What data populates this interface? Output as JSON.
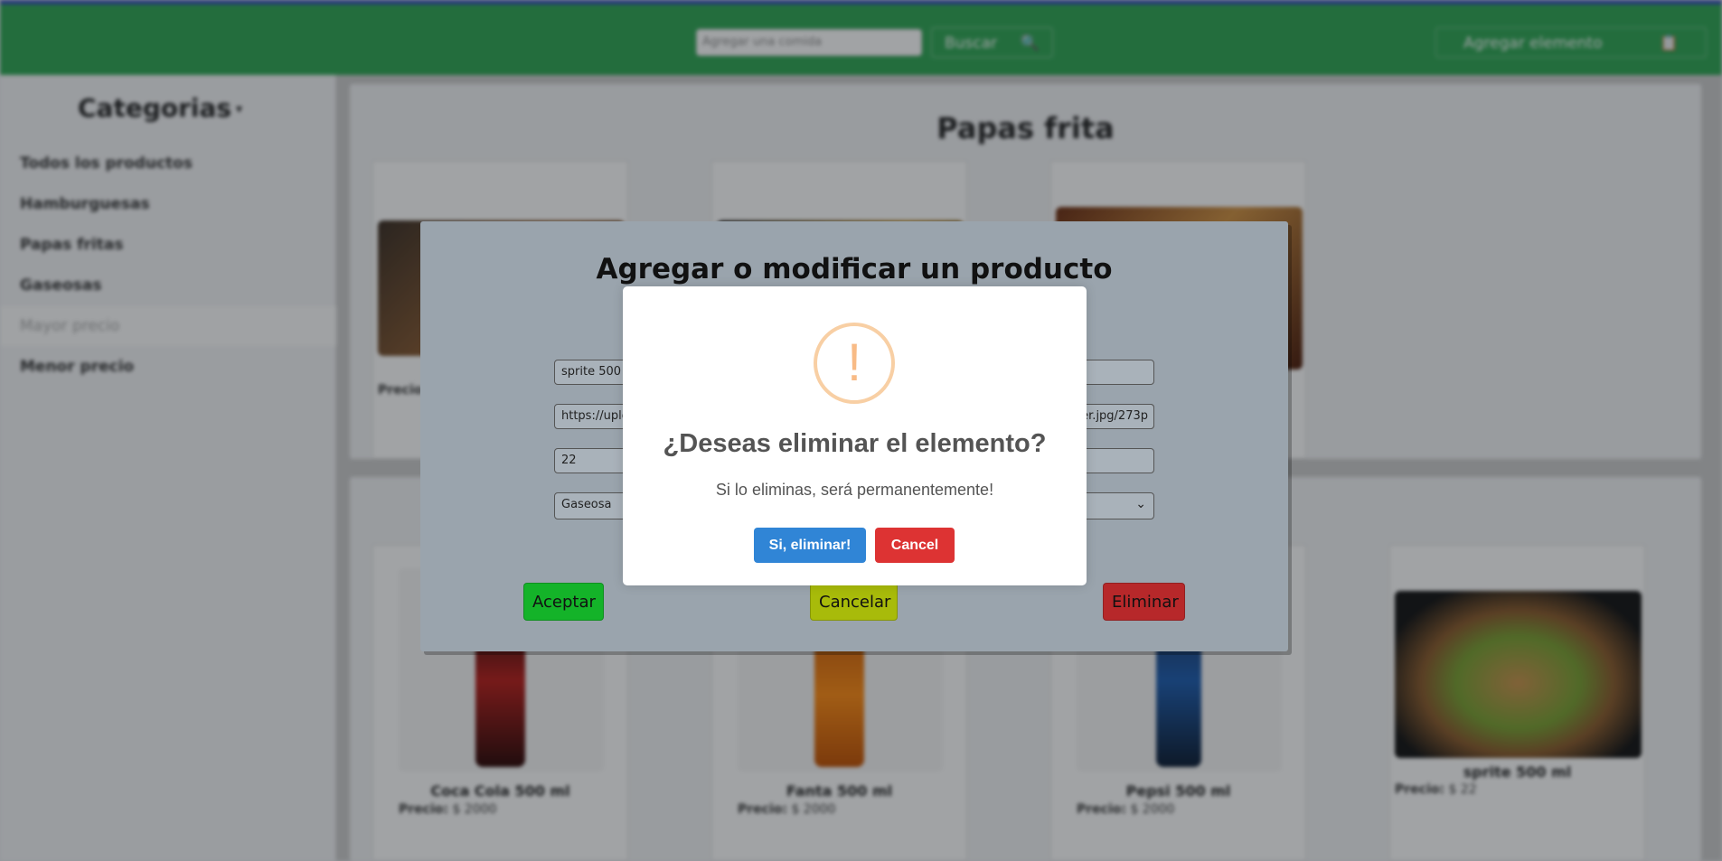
{
  "header": {
    "search_placeholder": "Agregar una comida",
    "search_label": "Buscar",
    "search_icon": "🔍",
    "add_label": "Agregar elemento",
    "add_icon": "📋"
  },
  "sidebar": {
    "title": "Categorias",
    "items": [
      {
        "label": "Todos los productos"
      },
      {
        "label": "Hamburguesas"
      },
      {
        "label": "Papas fritas"
      },
      {
        "label": "Gaseosas"
      },
      {
        "label": "Mayor precio"
      },
      {
        "label": "Menor precio"
      }
    ]
  },
  "main": {
    "section1_title": "Papas frita",
    "section1_price_label": "Precio",
    "cards": [
      {
        "name": "Coca Cola 500 ml",
        "price_label": "Precio:",
        "price": "$ 2000"
      },
      {
        "name": "Fanta 500 ml",
        "price_label": "Precio:",
        "price": "$ 2000"
      },
      {
        "name": "Pepsi 500 ml",
        "price_label": "Precio:",
        "price": "$ 2000"
      },
      {
        "name": "sprite 500 ml",
        "price_label": "Precio:",
        "price": "$ 22"
      }
    ]
  },
  "modal": {
    "title": "Agregar o modificar un producto",
    "name_value": "sprite 500",
    "url_value": "https://uplo",
    "url_value_tail": "er.jpg/273p",
    "price_value": "22",
    "category_value": "Gaseosa",
    "accept_label": "Aceptar",
    "cancel_label": "Cancelar",
    "delete_label": "Eliminar"
  },
  "dialog": {
    "icon": "!",
    "title": "¿Deseas eliminar el elemento?",
    "text": "Si lo eliminas, será permanentemente!",
    "confirm_label": "Si, eliminar!",
    "cancel_label": "Cancel"
  },
  "colors": {
    "header": "#2ea653",
    "confirm": "#3085d6",
    "cancel": "#dd3333",
    "warning": "#f8bb86"
  }
}
